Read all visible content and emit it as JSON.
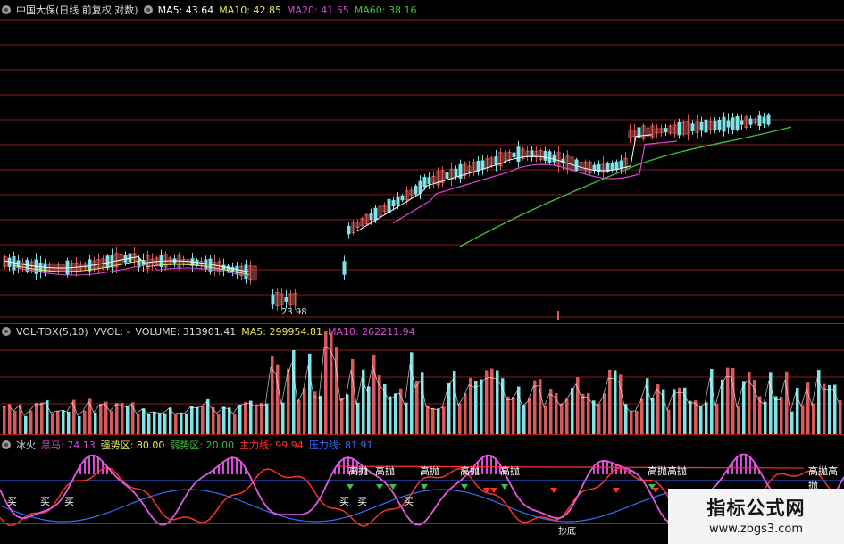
{
  "price_panel": {
    "stock_title": "中国大保(日线 前复权 对数)",
    "ma5": "MA5: 43.64",
    "ma10": "MA10: 42.85",
    "ma20": "MA20: 41.55",
    "ma60": "MA60: 38.16",
    "low_marker": "23.98"
  },
  "volume_panel": {
    "indicator": "VOL-TDX(5,10)",
    "vvol": "VVOL: -",
    "volume": "VOLUME: 313901.41",
    "ma5": "MA5: 299954.81",
    "ma10": "MA10: 262211.94"
  },
  "indicator_panel": {
    "name": "冰火",
    "heima": "黑马: 74.13",
    "strong_zone": "强势区: 80.00",
    "weak_zone": "弱势区: 20.00",
    "main_line": "主力线: 99.94",
    "pressure_line": "压力线: 81.91",
    "gaopao_labels": [
      "高抛",
      "高抛",
      "高抛",
      "高抛",
      "高抛",
      "高抛高抛",
      "高抛高抛"
    ],
    "mai_labels": [
      "买",
      "买",
      "买",
      "买",
      "买",
      "买"
    ],
    "bottom_label": "抄底"
  },
  "watermark": {
    "title": "指标公式网",
    "url": "www.zbgs3.com"
  },
  "colors": {
    "up": "#d85a5a",
    "down": "#7fe3e8",
    "ma5": "#ffffff",
    "ma10": "#e8e85a",
    "ma20": "#d84ad8",
    "ma60": "#40c040",
    "grid": "#8b1a1a"
  }
}
